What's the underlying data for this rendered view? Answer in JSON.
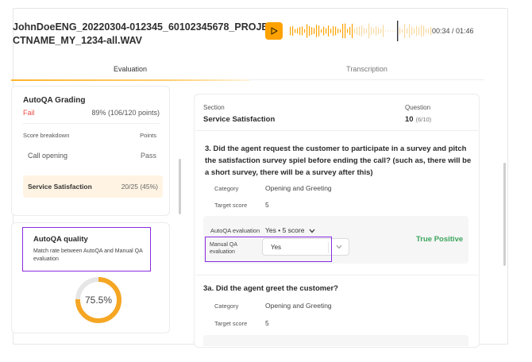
{
  "header": {
    "filename": "JohnDoeENG_20220304-012345_60102345678_PROJECTNAME_MY_1234-all.WAV",
    "time": "00:34 / 01:46"
  },
  "tabs": [
    {
      "label": "Evaluation",
      "active": true
    },
    {
      "label": "Transcription",
      "active": false
    }
  ],
  "grading": {
    "title": "AutoQA Grading",
    "result": "Fail",
    "points": "89% (106/120 points)",
    "breakdown_label": "Score breakdown",
    "points_label": "Points",
    "rows": [
      {
        "label": "Call opening",
        "value": "Pass"
      },
      {
        "label": "Service Satisfaction",
        "value": "20/25 (45%)"
      }
    ]
  },
  "quality": {
    "title": "AutoQA quality",
    "description": "Match rate between AutoQA and Manual QA evaluation",
    "percent_label": "75.5%",
    "percent": 75.5
  },
  "detail": {
    "section_label": "Section",
    "section_value": "Service Satisfaction",
    "question_label": "Question",
    "question_number": "10",
    "question_sub": "(6/10)",
    "question_text": "3. Did the agent request the customer to participate in a survey and pitch the satisfaction survey spiel before ending the call? (such as, there will be a short survey, there will be a survey after this)",
    "category_label": "Category",
    "category_value": "Opening and Greeting",
    "target_label": "Target score",
    "target_value": "5",
    "auto_eval_label": "AutoQA evaluation",
    "auto_eval_value": "Yes • 5 score",
    "manual_label": "Manual QA evaluation",
    "manual_value": "Yes",
    "match_result": "True Positive",
    "question2_text": "3a. Did the agent greet the customer?",
    "category2_value": "Opening and Greeting",
    "target2_value": "5"
  },
  "colors": {
    "accent": "#ffa200",
    "fail": "#e84a43",
    "success": "#3ba55c",
    "highlight": "#8a2be2"
  }
}
